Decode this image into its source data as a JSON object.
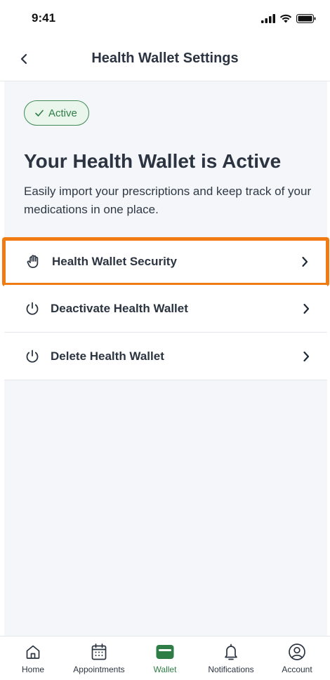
{
  "status": {
    "time": "9:41"
  },
  "header": {
    "title": "Health Wallet Settings"
  },
  "badge": {
    "label": "Active"
  },
  "hero": {
    "title": "Your Health Wallet is Active",
    "description": "Easily import your prescriptions and keep track of your medications in one place."
  },
  "menu": [
    {
      "label": "Health Wallet Security",
      "icon": "hand-icon"
    },
    {
      "label": "Deactivate Health Wallet",
      "icon": "power-icon"
    },
    {
      "label": "Delete Health Wallet",
      "icon": "power-icon"
    }
  ],
  "tabs": [
    {
      "label": "Home",
      "icon": "home-icon"
    },
    {
      "label": "Appointments",
      "icon": "calendar-icon"
    },
    {
      "label": "Wallet",
      "icon": "wallet-icon",
      "active": true
    },
    {
      "label": "Notifications",
      "icon": "bell-icon"
    },
    {
      "label": "Account",
      "icon": "account-icon"
    }
  ],
  "colors": {
    "accent_green": "#2e7d46",
    "highlight": "#f07b12"
  }
}
